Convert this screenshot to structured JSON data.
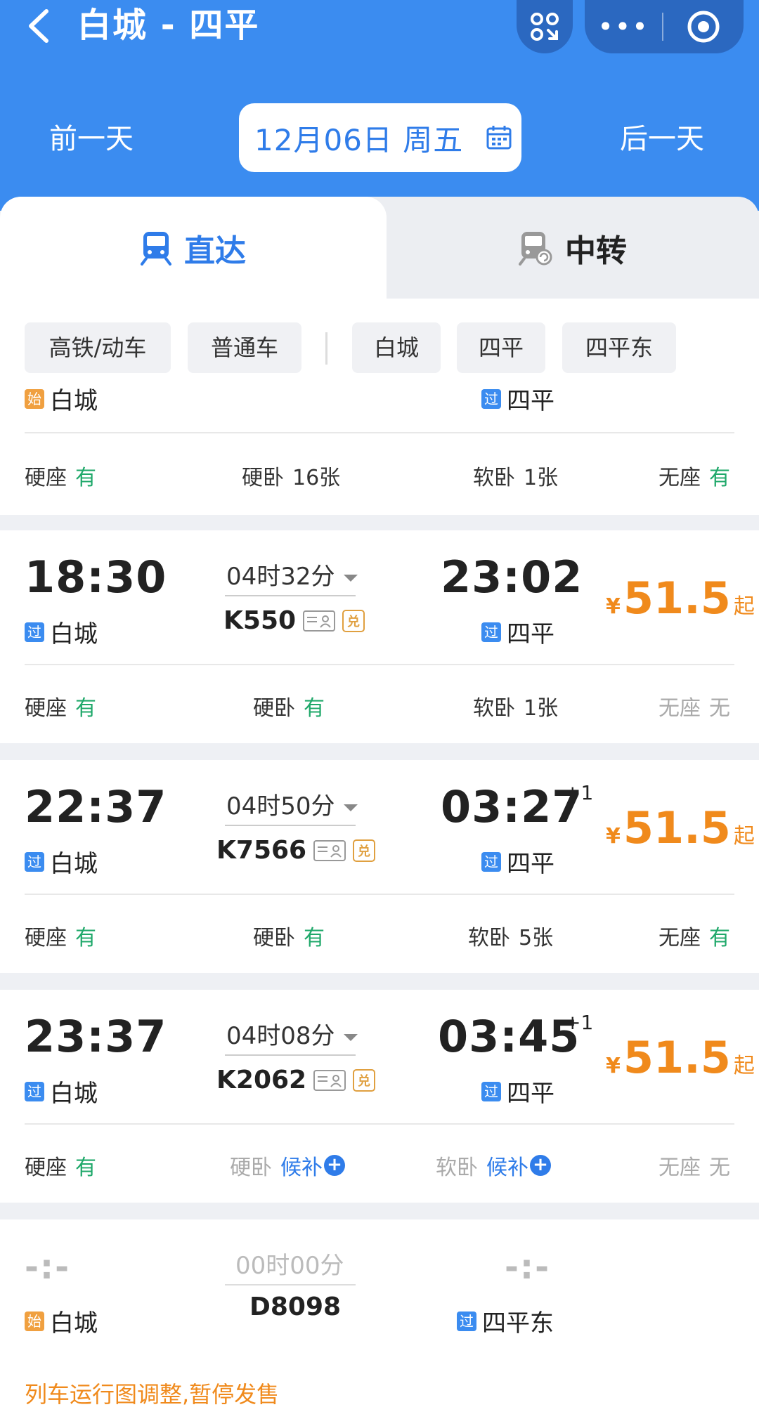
{
  "header": {
    "title": "白城 - 四平",
    "prev_day": "前一天",
    "next_day": "后一天",
    "date": "12月06日 周五",
    "menu_dots": "•••"
  },
  "tabs": [
    {
      "label": "直达",
      "active": true
    },
    {
      "label": "中转",
      "active": false
    }
  ],
  "filters": [
    "高铁/动车",
    "普通车",
    "白城",
    "四平",
    "四平东"
  ],
  "partial_row": {
    "dep_station": "白城",
    "dep_badge": "始",
    "arr_station": "四平",
    "arr_badge": "过",
    "seats": [
      {
        "name": "硬座",
        "value": "有"
      },
      {
        "name": "硬卧",
        "value": "16张"
      },
      {
        "name": "软卧",
        "value": "1张"
      },
      {
        "name": "无座",
        "value": "有"
      }
    ]
  },
  "trains": [
    {
      "dep_time": "18:30",
      "dep_badge": "过",
      "dep_station": "白城",
      "duration": "04时32分",
      "train_no": "K550",
      "arr_time": "23:02",
      "arr_badge": "过",
      "arr_station": "四平",
      "plus_one": "",
      "currency": "¥",
      "price": "51.5",
      "price_suffix": "起",
      "seats": [
        {
          "name": "硬座",
          "value": "有"
        },
        {
          "name": "硬卧",
          "value": "有"
        },
        {
          "name": "软卧",
          "value": "1张"
        },
        {
          "name": "无座",
          "value": "无"
        }
      ]
    },
    {
      "dep_time": "22:37",
      "dep_badge": "过",
      "dep_station": "白城",
      "duration": "04时50分",
      "train_no": "K7566",
      "arr_time": "03:27",
      "arr_badge": "过",
      "arr_station": "四平",
      "plus_one": "+1",
      "currency": "¥",
      "price": "51.5",
      "price_suffix": "起",
      "seats": [
        {
          "name": "硬座",
          "value": "有"
        },
        {
          "name": "硬卧",
          "value": "有"
        },
        {
          "name": "软卧",
          "value": "5张"
        },
        {
          "name": "无座",
          "value": "有"
        }
      ]
    },
    {
      "dep_time": "23:37",
      "dep_badge": "过",
      "dep_station": "白城",
      "duration": "04时08分",
      "train_no": "K2062",
      "arr_time": "03:45",
      "arr_badge": "过",
      "arr_station": "四平",
      "plus_one": "+1",
      "currency": "¥",
      "price": "51.5",
      "price_suffix": "起",
      "seats": [
        {
          "name": "硬座",
          "value": "有"
        },
        {
          "name": "硬卧",
          "value": "候补"
        },
        {
          "name": "软卧",
          "value": "候补"
        },
        {
          "name": "无座",
          "value": "无"
        }
      ]
    }
  ],
  "suspended_train": {
    "dep_time": "-:-",
    "dep_badge": "始",
    "dep_station": "白城",
    "duration": "00时00分",
    "train_no": "D8098",
    "arr_time": "-:-",
    "arr_badge": "过",
    "arr_station": "四平东",
    "notice": "列车运行图调整,暂停发售"
  },
  "colors": {
    "brand_blue": "#3b8cf0",
    "capsule": "#2b68c0",
    "price_orange": "#f08a1c",
    "available_green": "#1fa86a"
  }
}
